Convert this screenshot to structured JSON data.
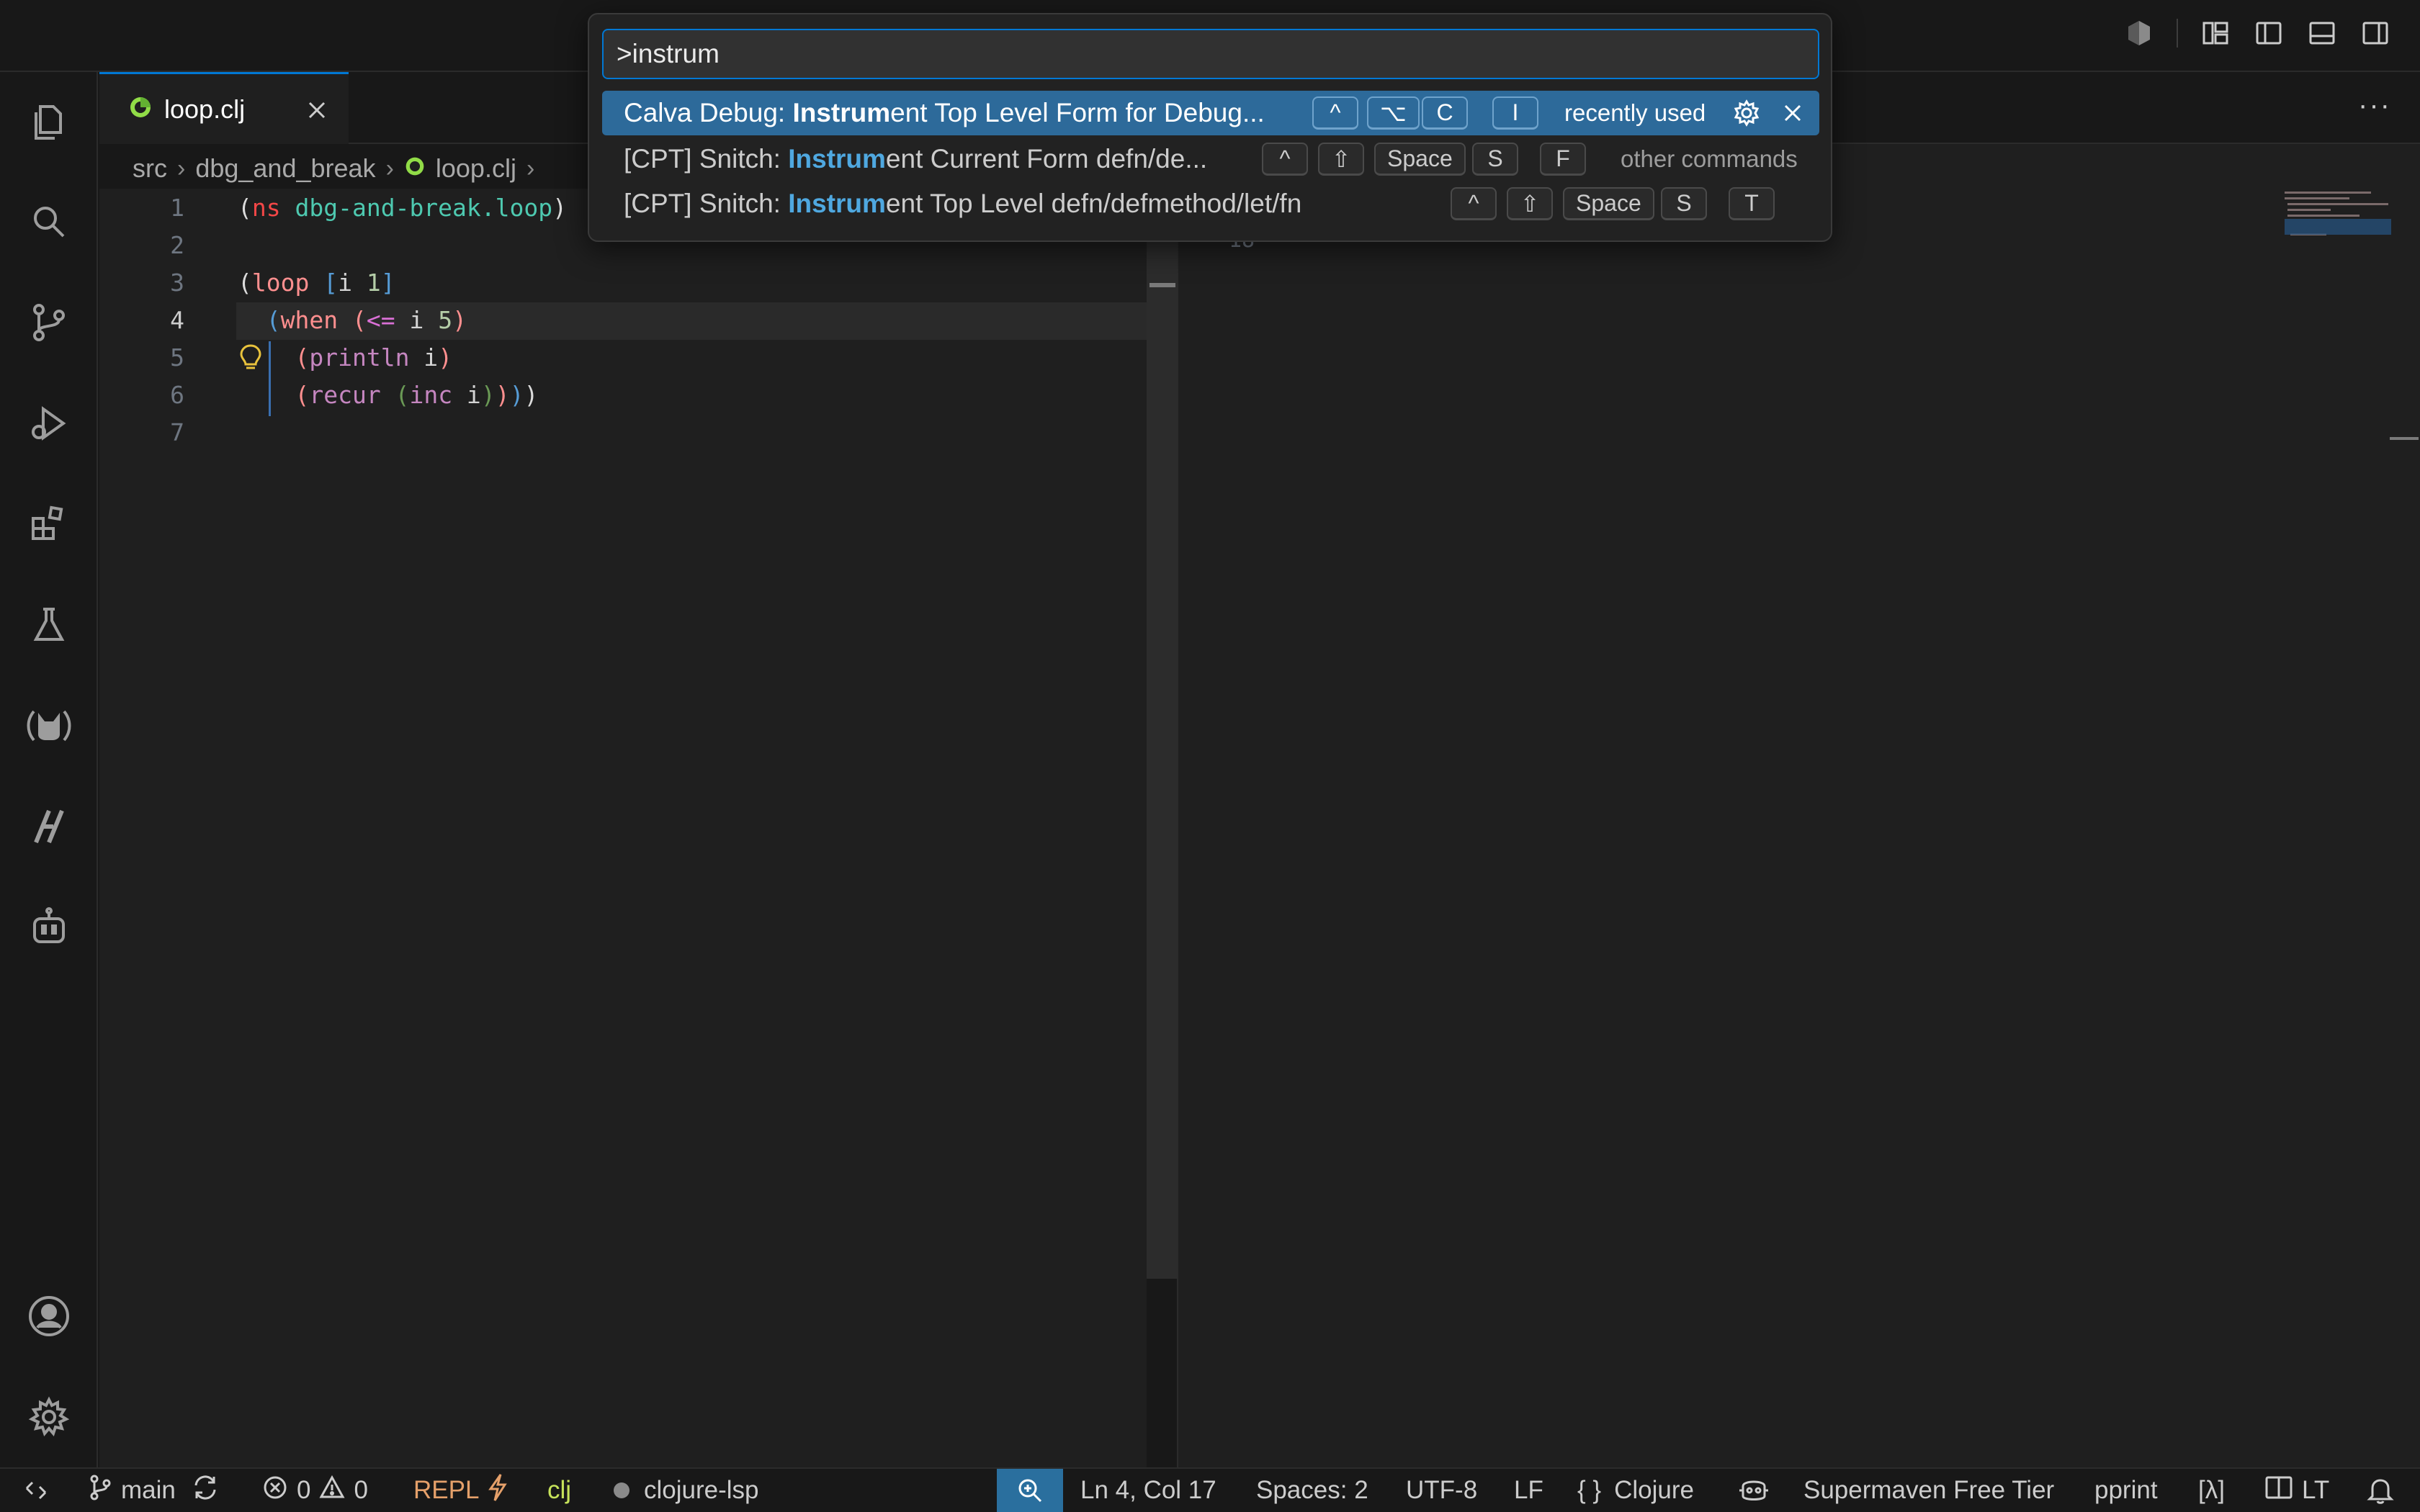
{
  "palette": {
    "query": ">instrum",
    "items": [
      {
        "prefix": "Calva Debug: ",
        "match": "Instrum",
        "suffix": "ent Top Level Form for Debug...",
        "keys": [
          "^",
          "⌥",
          "C",
          "I"
        ],
        "tag": "recently used",
        "selected": true
      },
      {
        "prefix": "[CPT] Snitch: ",
        "match": "Instrum",
        "suffix": "ent Current Form defn/de...",
        "keys": [
          "^",
          "⇧",
          "Space",
          "S",
          "F"
        ],
        "tag": "other commands",
        "selected": false
      },
      {
        "prefix": "[CPT] Snitch: ",
        "match": "Instrum",
        "suffix": "ent Top Level defn/defmethod/let/fn",
        "keys": [
          "^",
          "⇧",
          "Space",
          "S",
          "T"
        ],
        "tag": "",
        "selected": false
      }
    ]
  },
  "tab": {
    "label": "loop.clj"
  },
  "breadcrumb": [
    "src",
    "dbg_and_break",
    "loop.clj"
  ],
  "editor": {
    "line_numbers": [
      "1",
      "2",
      "3",
      "4",
      "5",
      "6",
      "7"
    ],
    "active_line": "4",
    "code": [
      "(ns dbg-and-break.loop)",
      "",
      "(loop [i 1]",
      "  (when (<= i 5)",
      "    (println i)",
      "    (recur (inc i))))",
      ""
    ]
  },
  "right_editor": {
    "visible_line_number": "18"
  },
  "statusbar": {
    "branch": "main",
    "errors": "0",
    "warnings": "0",
    "repl": "REPL",
    "lang_short": "clj",
    "lsp": "clojure-lsp",
    "position": "Ln 4, Col 17",
    "spaces": "Spaces: 2",
    "encoding": "UTF-8",
    "eol": "LF",
    "language": "Clojure",
    "supermaven": "Supermaven Free Tier",
    "pprint": "pprint",
    "lambda": "[λ]",
    "lt": "LT"
  },
  "colors": {
    "accent": "#0078d4",
    "selection": "#2d6a9a",
    "match": "#4fa8e0",
    "repl": "#e5a06a",
    "clj": "#c6e25a"
  }
}
